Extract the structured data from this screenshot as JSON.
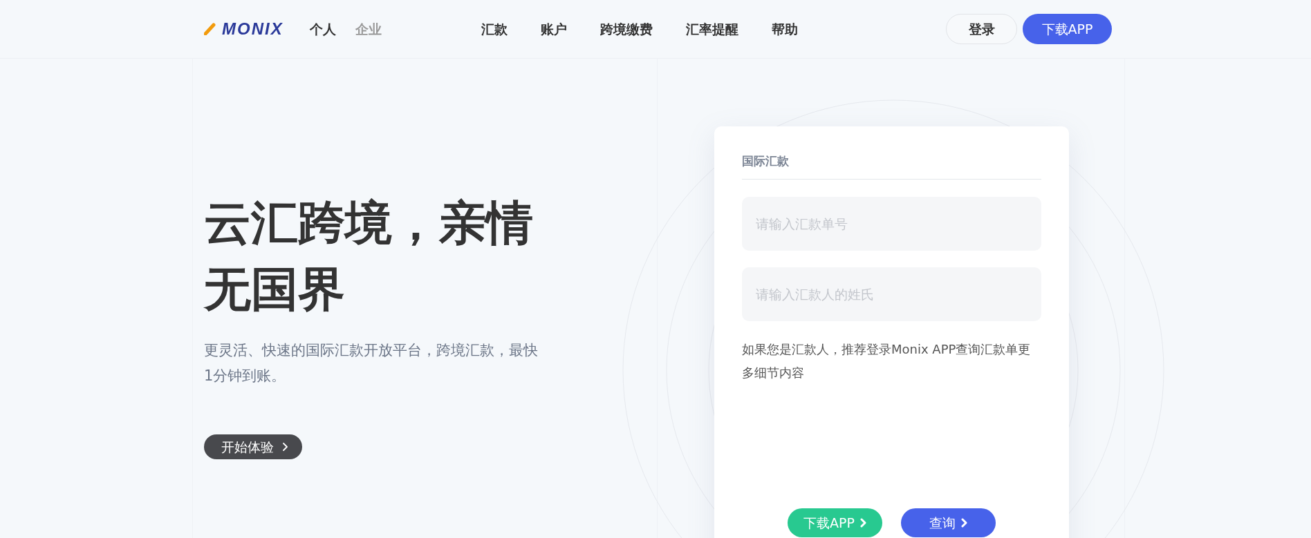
{
  "header": {
    "logo": "MONIX",
    "segments": [
      {
        "label": "个人",
        "selected": true
      },
      {
        "label": "企业",
        "selected": false
      }
    ],
    "nav": [
      "汇款",
      "账户",
      "跨境缴费",
      "汇率提醒",
      "帮助"
    ],
    "login": "登录",
    "download": "下载APP"
  },
  "hero": {
    "title": "云汇跨境，亲情无国界",
    "subtitle": "更灵活、快速的国际汇款开放平台，跨境汇款，最快1分钟到账。",
    "cta": "开始体验"
  },
  "card": {
    "title": "国际汇款",
    "fields": [
      {
        "placeholder": "请输入汇款单号"
      },
      {
        "placeholder": "请输入汇款人的姓氏"
      }
    ],
    "note": "如果您是汇款人，推荐登录Monix APP查询汇款单更多细节内容",
    "buttons": [
      {
        "label": "下载APP",
        "kind": "green"
      },
      {
        "label": "查询",
        "kind": "blue"
      }
    ]
  }
}
